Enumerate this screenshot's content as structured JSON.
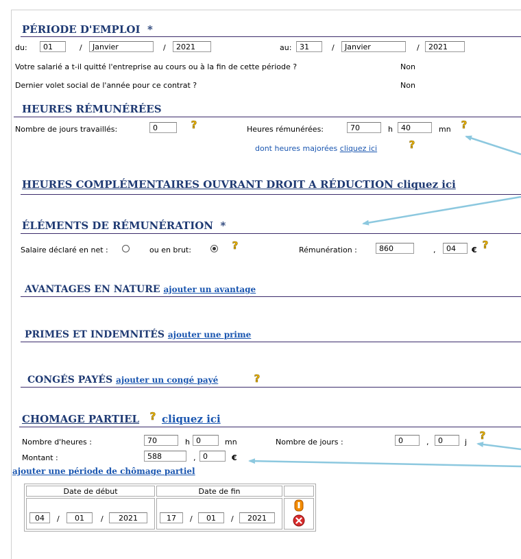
{
  "periode": {
    "title": "PÉRIODE D'EMPLOI",
    "required": "*",
    "du_label": "du:",
    "du_day": "01",
    "du_month": "Janvier",
    "du_year": "2021",
    "au_label": "au:",
    "au_day": "31",
    "au_month": "Janvier",
    "au_year": "2021",
    "slash": "/",
    "q1": "Votre salarié a t-il quitté l'entreprise au cours ou à la fin de cette période ?",
    "q1_value": "Non",
    "q2": "Dernier volet social de l'année pour ce contrat ?",
    "q2_value": "Non"
  },
  "heures": {
    "title": "HEURES RÉMUNÉRÉES",
    "jours_label": "Nombre de jours travaillés:",
    "jours_value": "0",
    "heures_label": "Heures rémunérées:",
    "heures_h": "70",
    "h_unit": "h",
    "heures_mn": "40",
    "mn_unit": "mn",
    "majorees_text": "dont heures majorées",
    "majorees_link": "cliquez ici"
  },
  "complementaires": {
    "title": "HEURES COMPLÉMENTAIRES OUVRANT DROIT A RÉDUCTION cliquez ici"
  },
  "elements": {
    "title": "ÉLÉMENTS DE RÉMUNÉRATION",
    "required": "*",
    "net_label": "Salaire déclaré en net :",
    "brut_label": "ou en brut:",
    "remun_label": "Rémunération :",
    "remun_int": "860",
    "comma": ",",
    "remun_dec": "04",
    "currency": "€"
  },
  "avantages": {
    "title": "AVANTAGES EN NATURE",
    "link": "ajouter un avantage"
  },
  "primes": {
    "title": "PRIMES ET INDEMNITÉS",
    "link": "ajouter une prime"
  },
  "conges": {
    "title": "CONGÉS PAYÉS",
    "link": "ajouter un congé payé"
  },
  "chomage": {
    "title": "CHOMAGE PARTIEL",
    "link": "cliquez ici",
    "heures_label": "Nombre d'heures :",
    "heures_h": "70",
    "h_unit": "h",
    "heures_mn": "0",
    "mn_unit": "mn",
    "jours_label": "Nombre de jours :",
    "jours_int": "0",
    "comma": ",",
    "jours_dec": "0",
    "j_unit": "j",
    "montant_label": "Montant :",
    "montant_int": "588",
    "montant_dec": "0",
    "currency": "€",
    "add_link": "ajouter une période de chômage partiel",
    "table": {
      "col_debut": "Date de début",
      "col_fin": "Date de fin",
      "debut_day": "04",
      "debut_month": "01",
      "debut_year": "2021",
      "fin_day": "17",
      "fin_month": "01",
      "fin_year": "2021",
      "slash": "/"
    }
  },
  "icons": {
    "help": "question-mark-icon",
    "edit": "pencil-icon",
    "delete": "delete-icon"
  },
  "colors": {
    "section_title": "#1f3a73",
    "link": "#1a56b0",
    "help_icon": "#e8b000",
    "arrow": "#8cc8df",
    "delete_icon": "#d92b2b",
    "edit_icon": "#f28b00"
  }
}
